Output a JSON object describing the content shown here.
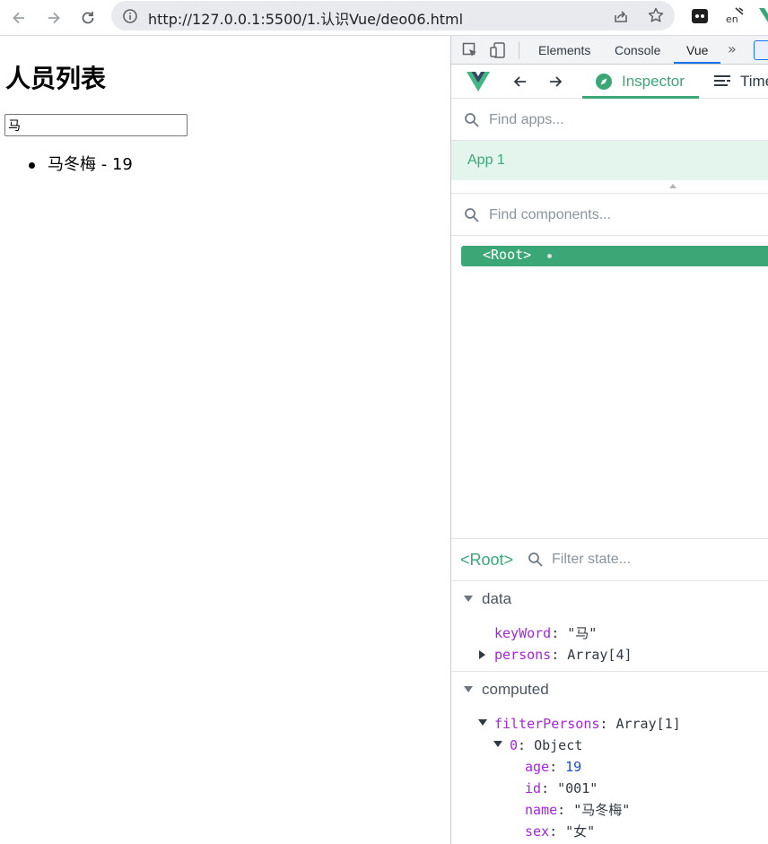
{
  "browser": {
    "url": "http://127.0.0.1:5500/1.认识Vue/deo06.html",
    "icons": [
      "back-icon",
      "forward-icon",
      "reload-icon",
      "info-icon",
      "share-icon",
      "star-icon",
      "extension-icon"
    ]
  },
  "page": {
    "title": "人员列表",
    "search_value": "马",
    "list": [
      {
        "text": "马冬梅 - 19"
      }
    ]
  },
  "devtools": {
    "tabs": [
      {
        "label": "Elements"
      },
      {
        "label": "Console"
      },
      {
        "label": "Vue"
      }
    ],
    "active_tab": "Vue",
    "vue": {
      "inspector_label": "Inspector",
      "timeline_label": "Time",
      "find_apps_placeholder": "Find apps...",
      "app_name": "App 1",
      "find_components_placeholder": "Find components...",
      "root_node": "<Root>",
      "state_root": "<Root>",
      "filter_state_placeholder": "Filter state...",
      "data_section": "data",
      "data": [
        {
          "key": "keyWord",
          "value": "\"马\""
        },
        {
          "key": "persons",
          "value": "Array[4]"
        }
      ],
      "computed_section": "computed",
      "computed": {
        "key": "filterPersons",
        "value": "Array[1]",
        "item_index": "0",
        "item_type": "Object",
        "fields": [
          {
            "key": "age",
            "value": "19"
          },
          {
            "key": "id",
            "value": "\"001\""
          },
          {
            "key": "name",
            "value": "\"马冬梅\""
          },
          {
            "key": "sex",
            "value": "\"女\""
          }
        ]
      }
    }
  },
  "colors": {
    "vue_green": "#3ba776",
    "app_row_bg": "#e3f5ec",
    "devtools_tab_accent": "#1a73e8",
    "prop_key": "#a626d8",
    "number": "#1c4fc9"
  }
}
